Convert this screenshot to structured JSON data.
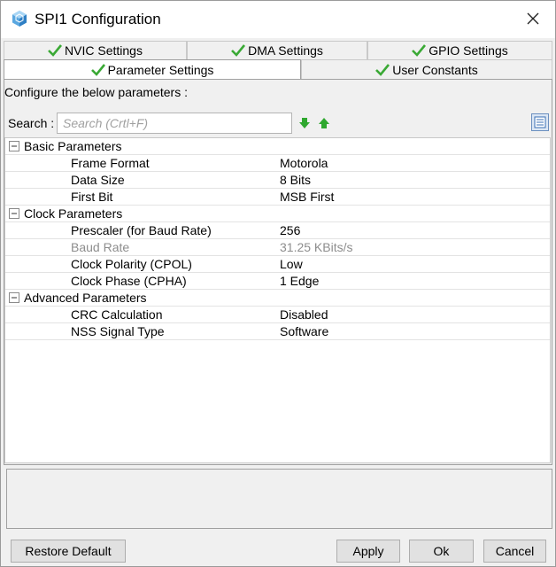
{
  "window": {
    "title": "SPI1 Configuration"
  },
  "tabs": {
    "row1": [
      {
        "label": "NVIC Settings",
        "checked": true
      },
      {
        "label": "DMA Settings",
        "checked": true
      },
      {
        "label": "GPIO Settings",
        "checked": true
      }
    ],
    "row2": [
      {
        "label": "Parameter Settings",
        "checked": true,
        "active": true
      },
      {
        "label": "User Constants",
        "checked": true
      }
    ]
  },
  "configure_label": "Configure the below parameters :",
  "search": {
    "label": "Search :",
    "placeholder": "Search (Crtl+F)"
  },
  "groups": [
    {
      "label": "Basic Parameters",
      "params": [
        {
          "name": "Frame Format",
          "value": "Motorola"
        },
        {
          "name": "Data Size",
          "value": "8 Bits"
        },
        {
          "name": "First Bit",
          "value": "MSB First"
        }
      ]
    },
    {
      "label": "Clock Parameters",
      "params": [
        {
          "name": "Prescaler (for Baud Rate)",
          "value": "256"
        },
        {
          "name": "Baud Rate",
          "value": "31.25 KBits/s",
          "disabled": true
        },
        {
          "name": "Clock Polarity (CPOL)",
          "value": "Low"
        },
        {
          "name": "Clock Phase (CPHA)",
          "value": "1 Edge"
        }
      ]
    },
    {
      "label": "Advanced Parameters",
      "params": [
        {
          "name": "CRC Calculation",
          "value": "Disabled"
        },
        {
          "name": "NSS Signal Type",
          "value": "Software"
        }
      ]
    }
  ],
  "buttons": {
    "restore": "Restore Default",
    "apply": "Apply",
    "ok": "Ok",
    "cancel": "Cancel"
  },
  "colors": {
    "check_green": "#3aa935",
    "arrow_green": "#2fa82f",
    "disabled_text": "#8d8d8d"
  }
}
